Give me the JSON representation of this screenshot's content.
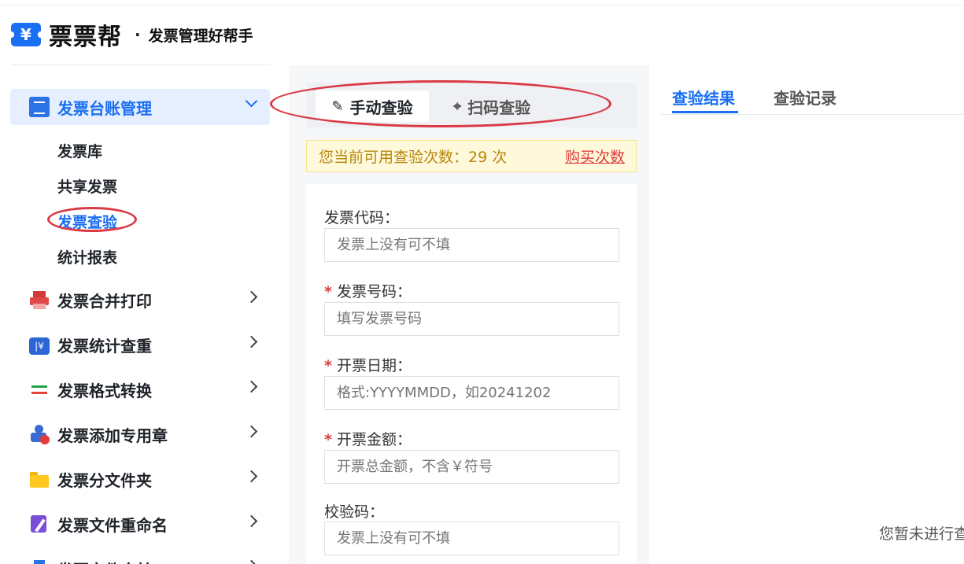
{
  "brand": {
    "name": "票票帮",
    "dot": "·",
    "slogan": "发票管理好帮手",
    "logo_symbol": "¥",
    "color": "#1a6ff2"
  },
  "sidebar": {
    "groups": [
      {
        "label": "发票台账管理",
        "icon": "ledger-icon",
        "expanded": true,
        "children": [
          {
            "label": "发票库"
          },
          {
            "label": "共享发票"
          },
          {
            "label": "发票查验",
            "current": true
          },
          {
            "label": "统计报表"
          }
        ]
      },
      {
        "label": "发票合并打印",
        "icon": "printer-icon"
      },
      {
        "label": "发票统计查重",
        "icon": "stats-ticket-icon",
        "icon_text": "|¥"
      },
      {
        "label": "发票格式转换",
        "icon": "convert-arrows-icon"
      },
      {
        "label": "发票添加专用章",
        "icon": "seal-stamp-icon"
      },
      {
        "label": "发票分文件夹",
        "icon": "folder-icon"
      },
      {
        "label": "发票文件重命名",
        "icon": "rename-edit-icon"
      },
      {
        "label": "发票文件合并",
        "icon": "merge-icon"
      }
    ]
  },
  "verify": {
    "tabs": [
      {
        "label": "手动查验",
        "icon": "pencil-icon",
        "glyph": "✎",
        "active": true
      },
      {
        "label": "扫码查验",
        "icon": "scanner-icon",
        "glyph": "⌖",
        "active": false
      }
    ],
    "quota_text": "您当前可用查验次数：29 次",
    "buy_label": "购买次数",
    "fields": [
      {
        "label": "发票代码：",
        "required": false,
        "placeholder": "发票上没有可不填",
        "value": ""
      },
      {
        "label": "发票号码：",
        "required": true,
        "placeholder": "填写发票号码",
        "value": ""
      },
      {
        "label": "开票日期：",
        "required": true,
        "placeholder": "格式:YYYYMMDD，如20241202",
        "value": ""
      },
      {
        "label": "开票金额：",
        "required": true,
        "placeholder": "开票总金额，不含￥符号",
        "value": ""
      },
      {
        "label": "校验码：",
        "required": false,
        "placeholder": "发票上没有可不填",
        "value": ""
      }
    ]
  },
  "results": {
    "tabs": [
      {
        "label": "查验结果",
        "active": true
      },
      {
        "label": "查验记录",
        "active": false
      }
    ],
    "empty_text": "您暂未进行查验"
  },
  "colors": {
    "accent": "#1a6ff2",
    "required": "#e03a3a",
    "annotation": "#d93a45",
    "quota_bg": "#fff9db"
  }
}
